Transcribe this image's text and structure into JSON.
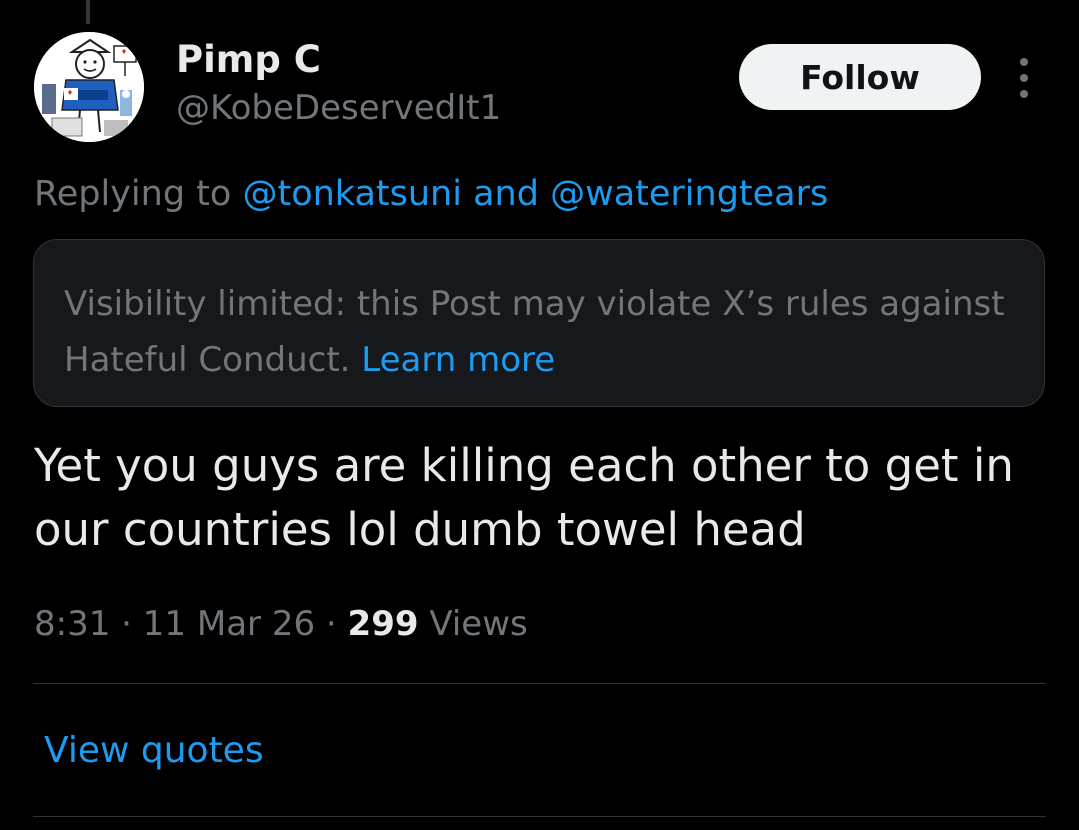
{
  "author": {
    "name": "Pimp C",
    "handle": "@KobeDeservedIt1",
    "avatar_icon": "cartoon-avatar-icon"
  },
  "actions": {
    "follow_label": "Follow",
    "more_icon": "more-options-icon"
  },
  "reply_context": {
    "prefix": "Replying to",
    "mentions": [
      "@tonkatsuni",
      "@wateringtears"
    ],
    "joiner": "and"
  },
  "notice": {
    "text": "Visibility limited: this Post may violate X’s rules against Hateful Conduct.",
    "link": "Learn more"
  },
  "post": {
    "text": "Yet you guys are killing each other to get in our countries lol dumb towel head"
  },
  "meta": {
    "time": "8:31",
    "separator": "·",
    "date": "11 Mar 26",
    "views_count": "299",
    "views_label": "Views"
  },
  "footer": {
    "view_quotes": "View quotes"
  },
  "colors": {
    "background": "#000000",
    "primary_text": "#e7e9ea",
    "secondary_text": "#71767b",
    "link": "#1d9bf0",
    "notice_bg": "#16181c",
    "border": "#2f3336"
  }
}
